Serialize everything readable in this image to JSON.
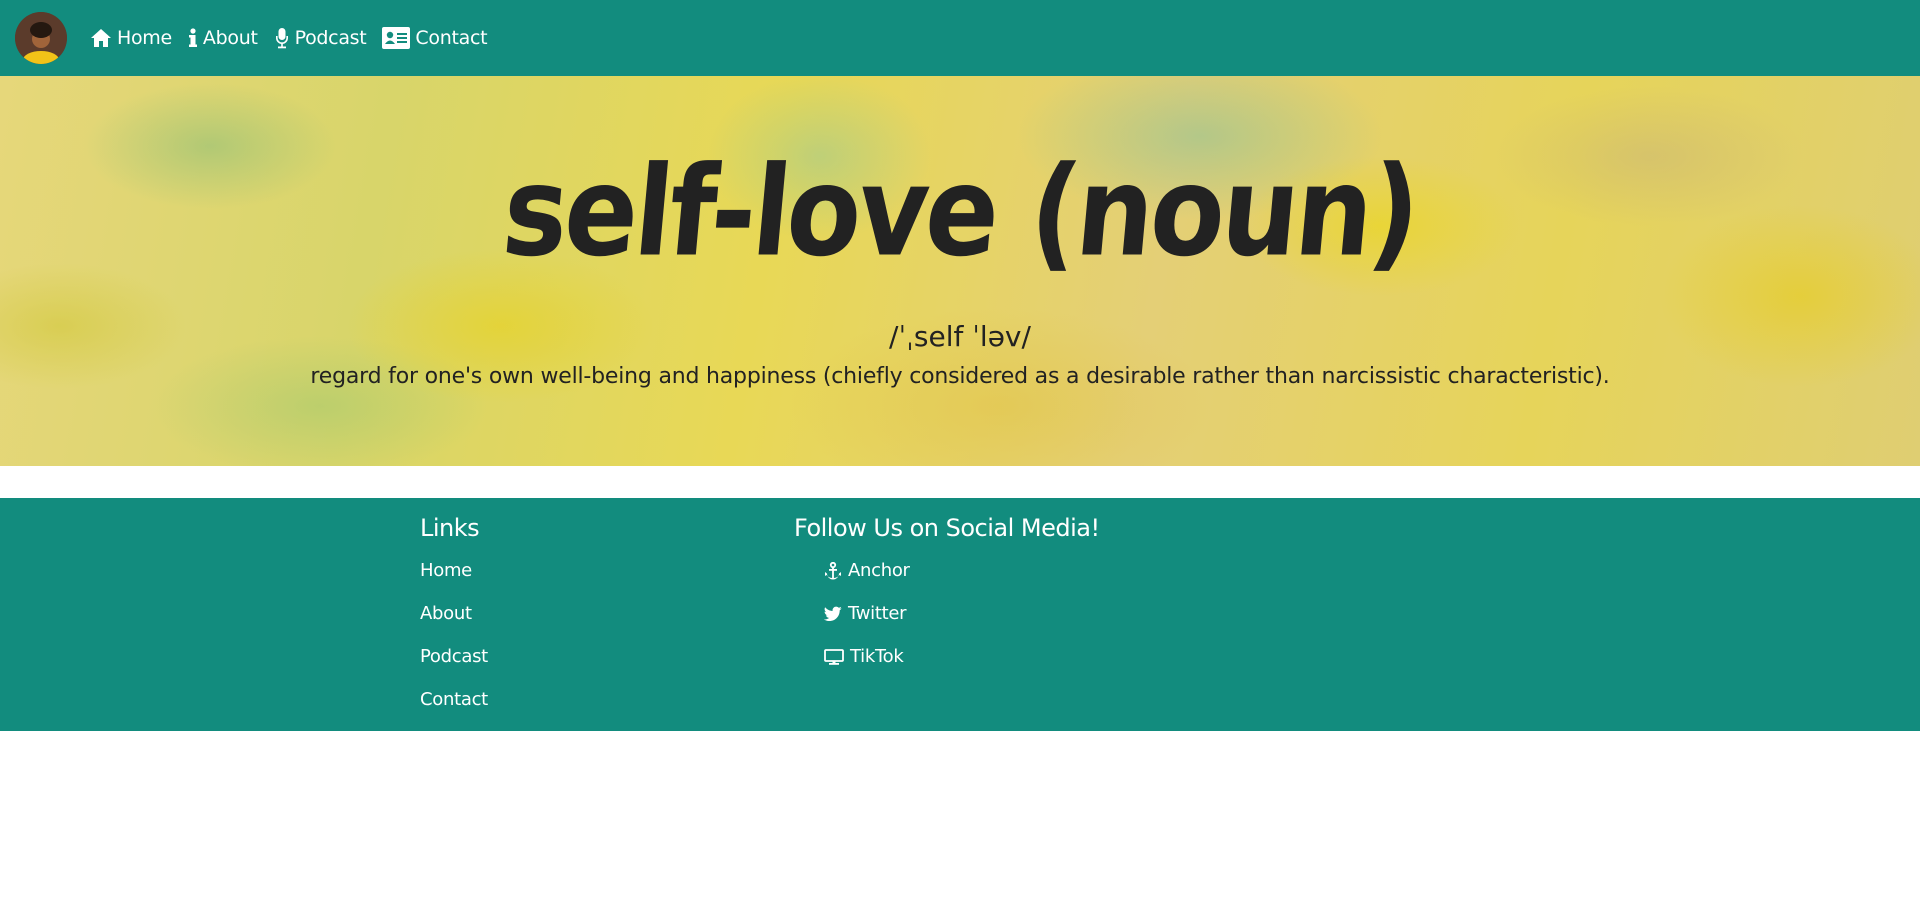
{
  "nav": {
    "items": [
      {
        "label": "Home",
        "icon": "home-icon"
      },
      {
        "label": "About",
        "icon": "info-icon"
      },
      {
        "label": "Podcast",
        "icon": "microphone-icon"
      },
      {
        "label": "Contact",
        "icon": "address-card-icon"
      }
    ]
  },
  "hero": {
    "title": "self-love (noun)",
    "pronunciation": "/ˈˌself ˈləv/",
    "definition": "regard for one's own well-being and happiness (chiefly considered as a desirable rather than narcissistic characteristic)."
  },
  "footer": {
    "links_heading": "Links",
    "links": [
      "Home",
      "About",
      "Podcast",
      "Contact"
    ],
    "social_heading": "Follow Us on Social Media!",
    "social": [
      {
        "label": "Anchor",
        "icon": "anchor-icon"
      },
      {
        "label": "Twitter",
        "icon": "twitter-icon"
      },
      {
        "label": "TikTok",
        "icon": "monitor-icon"
      }
    ]
  },
  "colors": {
    "brand": "#128c7e",
    "text_dark": "#222222",
    "hero_yellow": "#e6d45a"
  }
}
